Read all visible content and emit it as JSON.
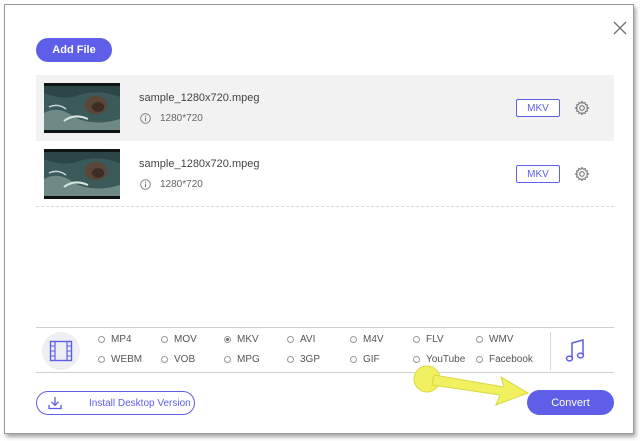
{
  "toolbar": {
    "add_file_label": "Add File"
  },
  "files": [
    {
      "name": "sample_1280x720.mpeg",
      "resolution": "1280*720",
      "format": "MKV",
      "selected": true
    },
    {
      "name": "sample_1280x720.mpeg",
      "resolution": "1280*720",
      "format": "MKV",
      "selected": false
    }
  ],
  "formats": {
    "row1": [
      "MP4",
      "MOV",
      "MKV",
      "AVI",
      "M4V",
      "FLV",
      "WMV"
    ],
    "row2": [
      "WEBM",
      "VOB",
      "MPG",
      "3GP",
      "GIF",
      "YouTube",
      "Facebook"
    ],
    "selected": "MKV"
  },
  "footer": {
    "install_label": "Install Desktop Version",
    "convert_label": "Convert"
  },
  "colors": {
    "accent": "#5e5ee8",
    "annotation": "#f0f060"
  },
  "icons": [
    "close-icon",
    "info-icon",
    "gear-icon",
    "film-icon",
    "music-icon",
    "download-icon"
  ]
}
